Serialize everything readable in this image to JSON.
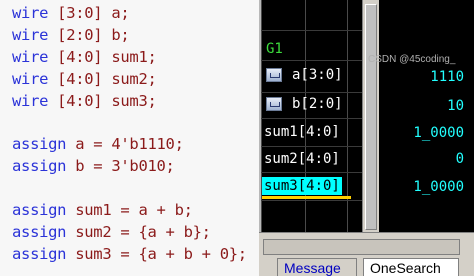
{
  "code": {
    "lines": [
      {
        "kw": "wire",
        "text": " [3:0] a;"
      },
      {
        "kw": "wire",
        "text": " [2:0] b;"
      },
      {
        "kw": "wire",
        "text": " [4:0] sum1;"
      },
      {
        "kw": "wire",
        "text": " [4:0] sum2;"
      },
      {
        "kw": "wire",
        "text": " [4:0] sum3;"
      },
      {
        "kw": "assign",
        "text": " a = 4'b1110;"
      },
      {
        "kw": "assign",
        "text": " b = 3'b010;"
      },
      {
        "kw": "assign",
        "text": " sum1 = a + b;"
      },
      {
        "kw": "assign",
        "text": " sum2 = {a + b};"
      },
      {
        "kw": "assign",
        "text": " sum3 = {a + b + 0};"
      }
    ]
  },
  "wave": {
    "group": "G1",
    "signals": [
      {
        "name": "a[3:0]",
        "value": "1110",
        "icon": "wave-icon"
      },
      {
        "name": "b[2:0]",
        "value": "10",
        "icon": "wave-icon"
      },
      {
        "name": "sum1[4:0]",
        "value": "1_0000",
        "icon": ""
      },
      {
        "name": "sum2[4:0]",
        "value": "0",
        "icon": ""
      },
      {
        "name": "sum3[4:0]",
        "value": "1_0000",
        "icon": "",
        "selected": true
      }
    ],
    "tabs": [
      "Message",
      "OneSearch"
    ],
    "watermark": "CSDN @45coding_"
  },
  "colors": {
    "keyword": "#2b33d8",
    "code_text": "#8b1a1a",
    "signal_value": "#22ffff",
    "group_label": "#3cdc3c",
    "selection": "#00ffff",
    "selection_underline": "#ffd000"
  }
}
